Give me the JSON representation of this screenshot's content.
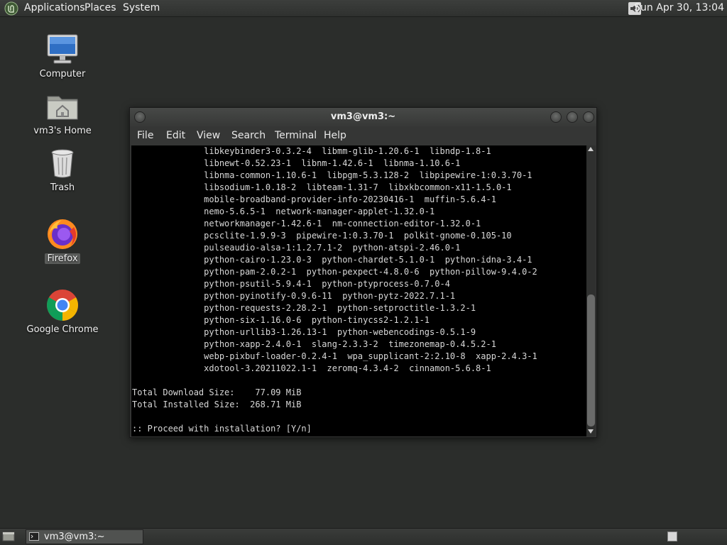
{
  "top_panel": {
    "menus": [
      "Applications",
      "Places",
      "System"
    ],
    "clock": "Sun Apr 30, 13:04",
    "icons": {
      "menu_logo": "mint-logo-icon",
      "volume": "speaker-icon"
    }
  },
  "desktop": {
    "icons": [
      {
        "label": "Computer",
        "icon": "computer-monitor-icon"
      },
      {
        "label": "vm3's Home",
        "icon": "home-folder-icon"
      },
      {
        "label": "Trash",
        "icon": "trash-bin-icon"
      },
      {
        "label": "Firefox",
        "icon": "firefox-icon"
      },
      {
        "label": "Google Chrome",
        "icon": "chrome-icon"
      }
    ]
  },
  "terminal": {
    "title": "vm3@vm3:~",
    "menu": [
      "File",
      "Edit",
      "View",
      "Search",
      "Terminal",
      "Help"
    ],
    "lines": [
      "              libkeybinder3-0.3.2-4  libmm-glib-1.20.6-1  libndp-1.8-1",
      "              libnewt-0.52.23-1  libnm-1.42.6-1  libnma-1.10.6-1",
      "              libnma-common-1.10.6-1  libpgm-5.3.128-2  libpipewire-1:0.3.70-1",
      "              libsodium-1.0.18-2  libteam-1.31-7  libxkbcommon-x11-1.5.0-1",
      "              mobile-broadband-provider-info-20230416-1  muffin-5.6.4-1",
      "              nemo-5.6.5-1  network-manager-applet-1.32.0-1",
      "              networkmanager-1.42.6-1  nm-connection-editor-1.32.0-1",
      "              pcsclite-1.9.9-3  pipewire-1:0.3.70-1  polkit-gnome-0.105-10",
      "              pulseaudio-alsa-1:1.2.7.1-2  python-atspi-2.46.0-1",
      "              python-cairo-1.23.0-3  python-chardet-5.1.0-1  python-idna-3.4-1",
      "              python-pam-2.0.2-1  python-pexpect-4.8.0-6  python-pillow-9.4.0-2",
      "              python-psutil-5.9.4-1  python-ptyprocess-0.7.0-4",
      "              python-pyinotify-0.9.6-11  python-pytz-2022.7.1-1",
      "              python-requests-2.28.2-1  python-setproctitle-1.3.2-1",
      "              python-six-1.16.0-6  python-tinycss2-1.2.1-1",
      "              python-urllib3-1.26.13-1  python-webencodings-0.5.1-9",
      "              python-xapp-2.4.0-1  slang-2.3.3-2  timezonemap-0.4.5.2-1",
      "              webp-pixbuf-loader-0.2.4-1  wpa_supplicant-2:2.10-8  xapp-2.4.3-1",
      "              xdotool-3.20211022.1-1  zeromq-4.3.4-2  cinnamon-5.6.8-1",
      "",
      "Total Download Size:    77.09 MiB",
      "Total Installed Size:  268.71 MiB",
      "",
      ":: Proceed with installation? [Y/n]"
    ]
  },
  "taskbar": {
    "task_label": "vm3@vm3:~",
    "icons": {
      "show_desktop": "show-desktop-icon",
      "task": "terminal-icon",
      "workspace": "workspace-switcher-icon"
    }
  }
}
